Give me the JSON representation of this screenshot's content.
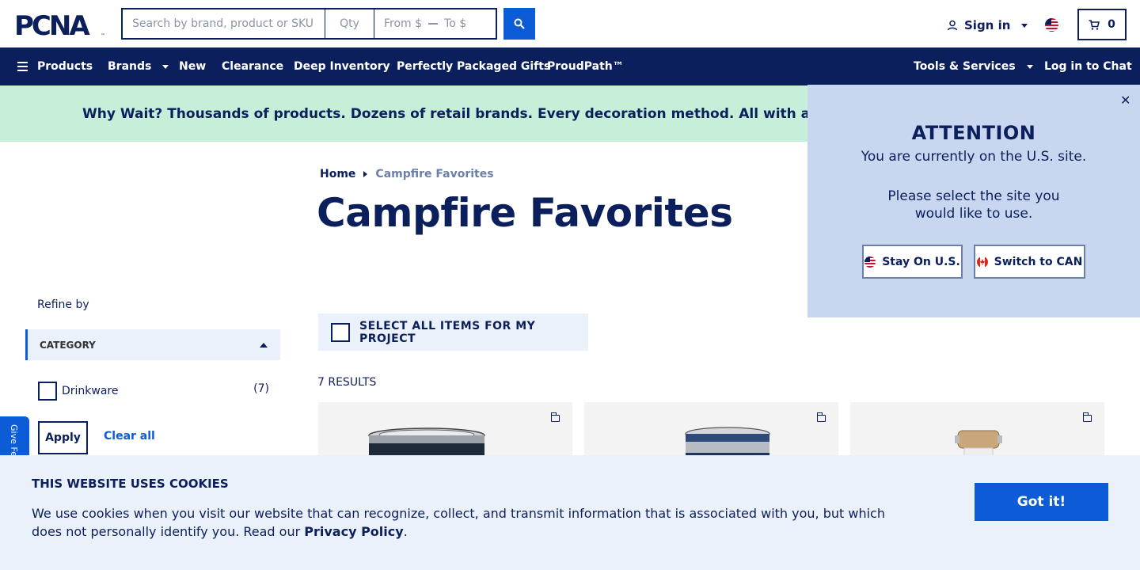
{
  "header": {
    "logo_text": "PCNA",
    "search_placeholder": "Search by brand, product or SKU",
    "qty_placeholder": "Qty",
    "price_from_placeholder": "From $",
    "price_to_placeholder": "To $",
    "signin_label": "Sign in",
    "cart_count": "0"
  },
  "nav": {
    "products": "Products",
    "brands": "Brands",
    "new": "New",
    "clearance": "Clearance",
    "deep_inventory": "Deep Inventory",
    "gifts": "Perfectly Packaged Gifts",
    "proudpath": "ProudPath™",
    "tools": "Tools & Services",
    "chat": "Log in to Chat"
  },
  "promo": {
    "text": "Why Wait? Thousands of products. Dozens of retail brands. Every decoration method. All with a standard"
  },
  "breadcrumb": {
    "home": "Home",
    "current": "Campfire Favorites"
  },
  "page": {
    "title": "Campfire Favorites",
    "results": "7 RESULTS",
    "select_all": "SELECT ALL ITEMS FOR MY PROJECT"
  },
  "filters": {
    "refine_by": "Refine by",
    "category_heading": "CATEGORY",
    "items": [
      {
        "label": "Drinkware",
        "count": "(7)"
      }
    ],
    "apply": "Apply",
    "clear_all": "Clear all"
  },
  "feedback": {
    "label": "Give Feedback"
  },
  "attention": {
    "title": "ATTENTION",
    "line1": "You are currently on the U.S. site.",
    "line2": "Please select the site you",
    "line3": "would like to use.",
    "stay_button": "Stay On U.S.",
    "switch_button": "Switch to CAN",
    "close": "✕"
  },
  "cookies": {
    "title": "THIS WEBSITE USES COOKIES",
    "body": "We use cookies when you visit our website that can recognize, collect, and transmit information that is associated with you, but which does not personally identify you. Read our ",
    "link": "Privacy Policy",
    "period": ".",
    "button": "Got it!"
  },
  "colors": {
    "navy": "#0b1f5c",
    "blue": "#0b5cd6",
    "promo_bg": "#c6eed8",
    "attention_bg": "#c8d6f0",
    "cookie_bg": "#ebf1fb"
  }
}
